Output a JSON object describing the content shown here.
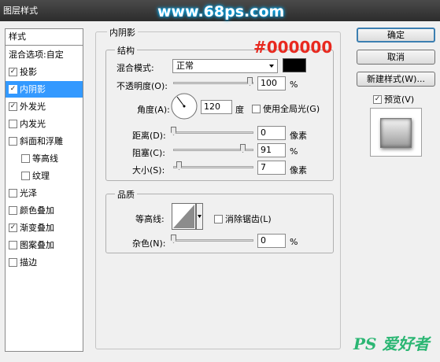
{
  "window_title": "图层样式",
  "watermark": "www.68ps.com",
  "annotation_color_hex": "#000000",
  "left_panel": {
    "header": "样式",
    "items": [
      {
        "label": "混合选项:自定",
        "has_checkbox": false,
        "checked": false,
        "selected": false,
        "indent": false
      },
      {
        "label": "投影",
        "has_checkbox": true,
        "checked": true,
        "selected": false,
        "indent": false
      },
      {
        "label": "内阴影",
        "has_checkbox": true,
        "checked": true,
        "selected": true,
        "indent": false
      },
      {
        "label": "外发光",
        "has_checkbox": true,
        "checked": true,
        "selected": false,
        "indent": false
      },
      {
        "label": "内发光",
        "has_checkbox": true,
        "checked": false,
        "selected": false,
        "indent": false
      },
      {
        "label": "斜面和浮雕",
        "has_checkbox": true,
        "checked": false,
        "selected": false,
        "indent": false
      },
      {
        "label": "等高线",
        "has_checkbox": true,
        "checked": false,
        "selected": false,
        "indent": true
      },
      {
        "label": "纹理",
        "has_checkbox": true,
        "checked": false,
        "selected": false,
        "indent": true
      },
      {
        "label": "光泽",
        "has_checkbox": true,
        "checked": false,
        "selected": false,
        "indent": false
      },
      {
        "label": "颜色叠加",
        "has_checkbox": true,
        "checked": false,
        "selected": false,
        "indent": false
      },
      {
        "label": "渐变叠加",
        "has_checkbox": true,
        "checked": true,
        "selected": false,
        "indent": false
      },
      {
        "label": "图案叠加",
        "has_checkbox": true,
        "checked": false,
        "selected": false,
        "indent": false
      },
      {
        "label": "描边",
        "has_checkbox": true,
        "checked": false,
        "selected": false,
        "indent": false
      }
    ]
  },
  "inner_shadow": {
    "section_title": "内阴影",
    "structure": {
      "title": "结构",
      "blend_mode_label": "混合模式:",
      "blend_mode_value": "正常",
      "shadow_color": "#000000",
      "opacity_label": "不透明度(O):",
      "opacity_value": "100",
      "opacity_unit": "%",
      "angle_label": "角度(A):",
      "angle_value": "120",
      "angle_unit": "度",
      "global_light_label": "使用全局光(G)",
      "global_light_checked": false,
      "distance_label": "距离(D):",
      "distance_value": "0",
      "distance_unit": "像素",
      "choke_label": "阻塞(C):",
      "choke_value": "91",
      "choke_unit": "%",
      "size_label": "大小(S):",
      "size_value": "7",
      "size_unit": "像素"
    },
    "quality": {
      "title": "品质",
      "contour_label": "等高线:",
      "anti_alias_label": "消除锯齿(L)",
      "anti_alias_checked": false,
      "noise_label": "杂色(N):",
      "noise_value": "0",
      "noise_unit": "%"
    }
  },
  "buttons": {
    "ok": "确定",
    "cancel": "取消",
    "new_style": "新建样式(W)...",
    "preview_label": "预览(V)",
    "preview_checked": true
  },
  "logo": {
    "text": "PS 爱好者",
    "color": "#2bb673"
  }
}
